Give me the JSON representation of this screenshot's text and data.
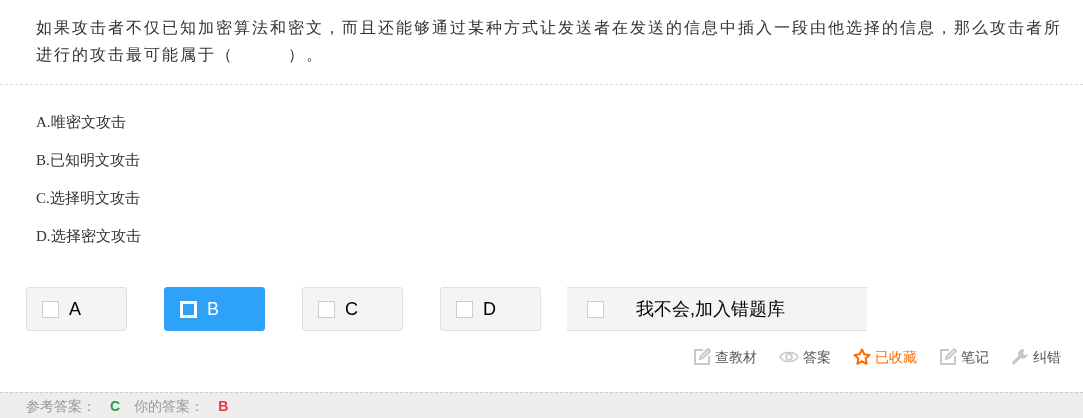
{
  "question": "如果攻击者不仅已知加密算法和密文，而且还能够通过某种方式让发送者在发送的信息中插入一段由他选择的信息，那么攻击者所进行的攻击最可能属于（　　　）。",
  "options": [
    "A.唯密文攻击",
    "B.已知明文攻击",
    "C.选择明文攻击",
    "D.选择密文攻击"
  ],
  "answer_buttons": [
    {
      "label": "A",
      "selected": false
    },
    {
      "label": "B",
      "selected": true
    },
    {
      "label": "C",
      "selected": false
    },
    {
      "label": "D",
      "selected": false
    }
  ],
  "unknown_button": {
    "label": "我不会,加入错题库",
    "selected": false
  },
  "tools": [
    {
      "kind": "edit",
      "label": "查教材",
      "active": false
    },
    {
      "kind": "eye",
      "label": "答案",
      "active": false
    },
    {
      "kind": "star",
      "label": "已收藏",
      "active": true
    },
    {
      "kind": "edit",
      "label": "笔记",
      "active": false
    },
    {
      "kind": "wrench",
      "label": "纠错",
      "active": false
    }
  ],
  "result": [
    {
      "kind": "label",
      "text": "参考答案："
    },
    {
      "kind": "correct",
      "text": "C"
    },
    {
      "kind": "label",
      "text": "你的答案："
    },
    {
      "kind": "wrong",
      "text": "B"
    }
  ]
}
